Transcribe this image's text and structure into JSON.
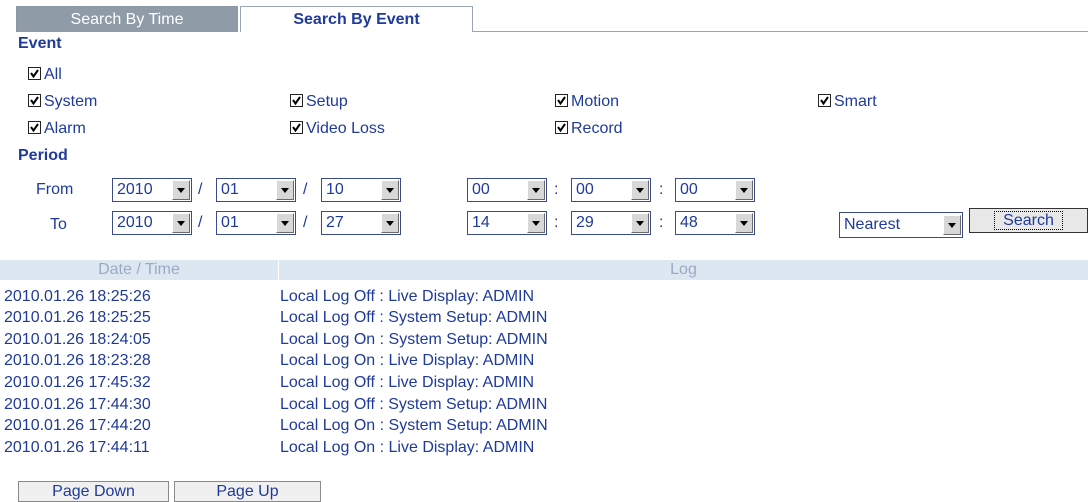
{
  "tabs": {
    "time": "Search By Time",
    "event": "Search By Event"
  },
  "event": {
    "heading": "Event",
    "items": {
      "all": "All",
      "system": "System",
      "setup": "Setup",
      "motion": "Motion",
      "smart": "Smart",
      "alarm": "Alarm",
      "video_loss": "Video Loss",
      "record": "Record"
    },
    "checked": true
  },
  "period": {
    "heading": "Period",
    "from_label": "From",
    "to_label": "To",
    "from": {
      "year": "2010",
      "month": "01",
      "day": "10",
      "hour": "00",
      "minute": "00",
      "second": "00"
    },
    "to": {
      "year": "2010",
      "month": "01",
      "day": "27",
      "hour": "14",
      "minute": "29",
      "second": "48"
    },
    "date_sep": "/",
    "time_sep": ":"
  },
  "mode": {
    "selected": "Nearest"
  },
  "search_label": "Search",
  "log": {
    "columns": [
      "Date / Time",
      "Log"
    ],
    "rows": [
      [
        "2010.01.26  18:25:26",
        "Local Log Off : Live Display: ADMIN"
      ],
      [
        "2010.01.26  18:25:25",
        "Local Log Off : System Setup: ADMIN"
      ],
      [
        "2010.01.26  18:24:05",
        "Local Log On : System Setup: ADMIN"
      ],
      [
        "2010.01.26  18:23:28",
        "Local Log On : Live Display: ADMIN"
      ],
      [
        "2010.01.26  17:45:32",
        "Local Log Off : Live Display: ADMIN"
      ],
      [
        "2010.01.26  17:44:30",
        "Local Log Off : System Setup: ADMIN"
      ],
      [
        "2010.01.26  17:44:20",
        "Local Log On : System Setup: ADMIN"
      ],
      [
        "2010.01.26  17:44:11",
        "Local Log On : Live Display: ADMIN"
      ]
    ]
  },
  "paging": {
    "down": "Page Down",
    "up": "Page Up"
  }
}
